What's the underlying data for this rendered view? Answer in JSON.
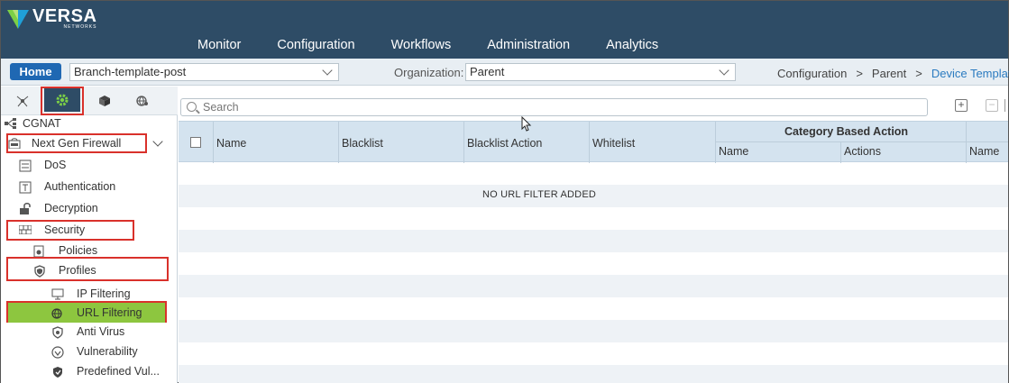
{
  "header": {
    "logo_text": "VERSA",
    "logo_subtext": "NETWORKS",
    "nav": [
      "Monitor",
      "Configuration",
      "Workflows",
      "Administration",
      "Analytics"
    ]
  },
  "subbar": {
    "home_label": "Home",
    "template_select": "Branch-template-post",
    "org_label": "Organization:",
    "org_select": "Parent",
    "breadcrumb": [
      "Configuration",
      "Parent",
      "Device Templat"
    ]
  },
  "sidebar": {
    "tabs": [
      "network-icon",
      "gear-icon",
      "cube-icon",
      "globe-icon"
    ],
    "items": [
      {
        "label": "CGNAT",
        "icon": "network-icon"
      },
      {
        "label": "Next Gen Firewall",
        "icon": "firewall-icon"
      },
      {
        "label": "DoS",
        "icon": "dos-icon"
      },
      {
        "label": "Authentication",
        "icon": "auth-icon"
      },
      {
        "label": "Decryption",
        "icon": "unlock-icon"
      },
      {
        "label": "Security",
        "icon": "brick-wall-icon"
      },
      {
        "label": "Policies",
        "icon": "policy-icon"
      },
      {
        "label": "Profiles",
        "icon": "shield-icon"
      },
      {
        "label": "IP Filtering",
        "icon": "monitor-icon"
      },
      {
        "label": "URL Filtering",
        "icon": "globe-icon"
      },
      {
        "label": "Anti Virus",
        "icon": "shield-icon"
      },
      {
        "label": "Vulnerability",
        "icon": "target-icon"
      },
      {
        "label": "Predefined Vul...",
        "icon": "shield-icon"
      }
    ]
  },
  "main": {
    "search_placeholder": "Search",
    "columns": {
      "name": "Name",
      "blacklist": "Blacklist",
      "blacklist_action": "Blacklist Action",
      "whitelist": "Whitelist",
      "category_group": "Category Based Action",
      "cat_name": "Name",
      "cat_actions": "Actions",
      "extra_name": "Name"
    },
    "empty_message": "NO URL FILTER ADDED"
  },
  "colors": {
    "header_bg": "#2e4c66",
    "accent_blue": "#1f68b3",
    "selected_green": "#8dc63f",
    "highlight_red": "#d9312b",
    "table_header_bg": "#d4e3ef"
  }
}
